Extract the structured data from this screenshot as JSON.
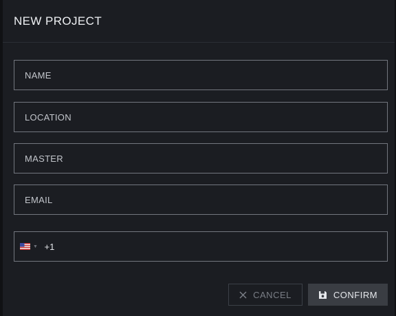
{
  "dialog": {
    "title": "NEW PROJECT"
  },
  "form": {
    "name_placeholder": "NAME",
    "location_placeholder": "LOCATION",
    "master_placeholder": "MASTER",
    "email_placeholder": "EMAIL",
    "phone": {
      "country_icon": "us-flag-icon",
      "dial_code": "+1",
      "value": ""
    }
  },
  "actions": {
    "cancel_label": "CANCEL",
    "confirm_label": "CONFIRM",
    "cancel_icon": "close-icon",
    "confirm_icon": "save-icon"
  }
}
